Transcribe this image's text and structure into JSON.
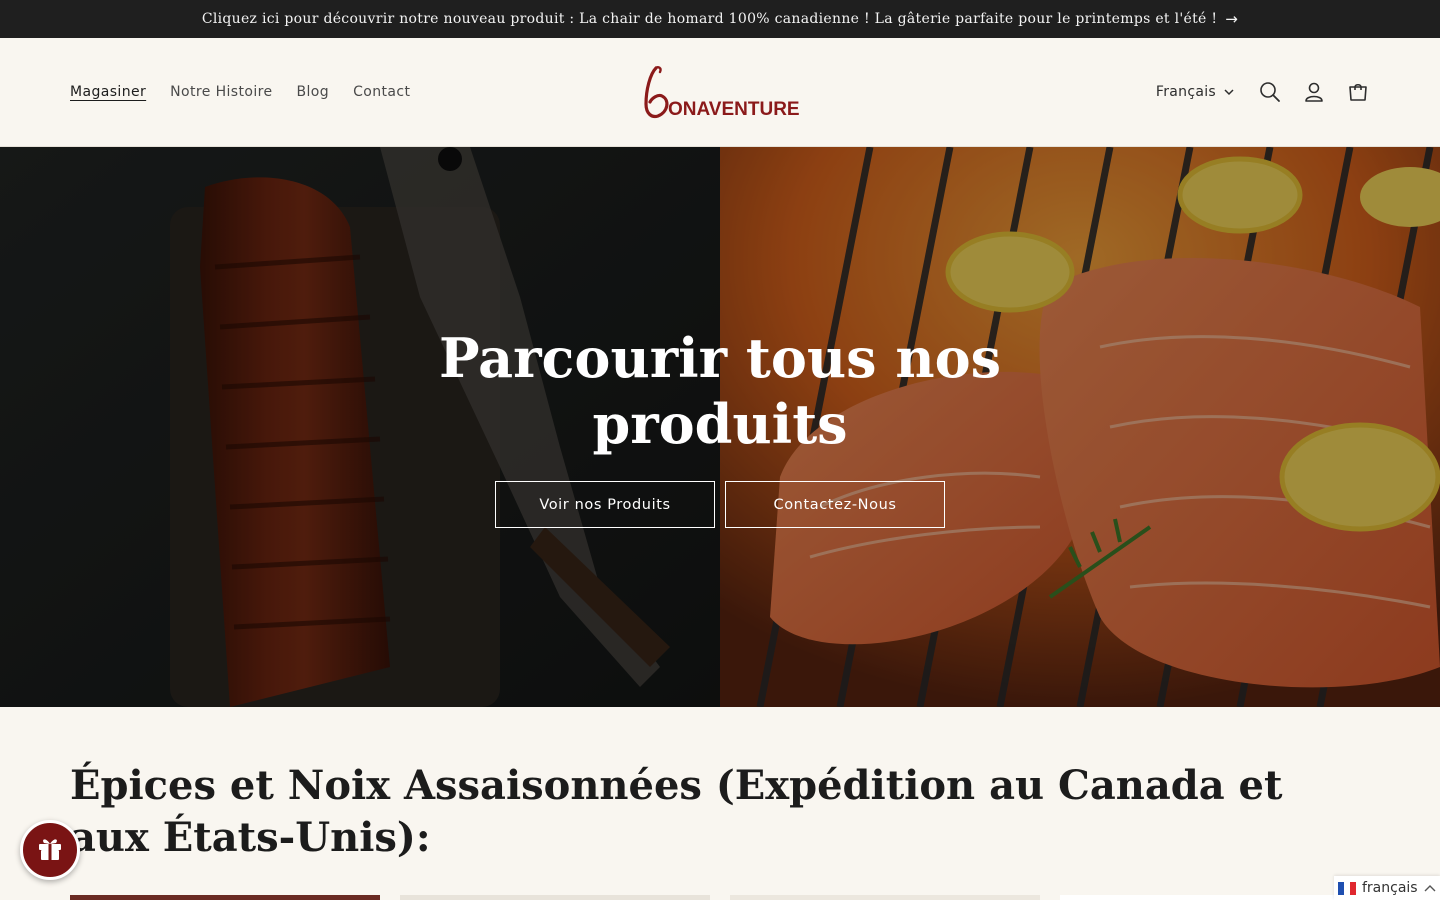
{
  "announcement": {
    "text": "Cliquez ici pour découvrir notre nouveau produit : La chair de homard 100% canadienne ! La gâterie parfaite pour le printemps et l'été !",
    "arrow": "→"
  },
  "nav": {
    "items": [
      {
        "label": "Magasiner",
        "active": true
      },
      {
        "label": "Notre Histoire"
      },
      {
        "label": "Blog"
      },
      {
        "label": "Contact"
      }
    ]
  },
  "logo": {
    "initial": "B",
    "text": "ONAVENTURE",
    "color": "#8b1a1a"
  },
  "header": {
    "language": "Français",
    "icons": [
      "chevron-down-icon",
      "search-icon",
      "account-icon",
      "cart-icon"
    ]
  },
  "hero": {
    "title_line1": "Parcourir tous nos",
    "title_line2": "produits",
    "button_primary": "Voir nos Produits",
    "button_secondary": "Contactez-Nous"
  },
  "section": {
    "title": "Épices et Noix Assaisonnées (Expédition au Canada et aux États-Unis):"
  },
  "widgets": {
    "gift_icon": "gift-icon",
    "language_widget": "français",
    "language_chevron": "chevron-up-icon"
  },
  "colors": {
    "announcement_bg": "#1f1f1f",
    "page_bg": "#f9f6f0",
    "brand": "#8b1a1a",
    "gift_button": "#7a1414"
  }
}
